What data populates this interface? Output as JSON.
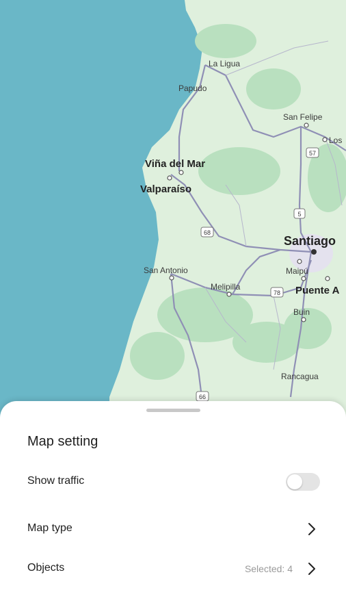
{
  "map": {
    "places": {
      "la_ligua": "La Ligua",
      "papudo": "Papudo",
      "san_felipe": "San Felipe",
      "los": "Los",
      "vina_del_mar": "Viña del Mar",
      "valparaiso": "Valparaíso",
      "santiago": "Santiago",
      "maipu": "Maipú",
      "puente_alto": "Puente A",
      "san_antonio": "San Antonio",
      "melipilla": "Melipilla",
      "buin": "Buin",
      "rancagua": "Rancagua"
    },
    "route_shields": [
      "57",
      "5",
      "68",
      "78",
      "66"
    ],
    "colors": {
      "ocean": "#6ab7c7",
      "land": "#dff0dd",
      "road": "#8f8fb5"
    }
  },
  "sheet": {
    "title": "Map setting",
    "show_traffic": {
      "label": "Show traffic",
      "enabled": false
    },
    "map_type": {
      "label": "Map type"
    },
    "objects": {
      "label": "Objects",
      "value": "Selected: 4"
    }
  }
}
